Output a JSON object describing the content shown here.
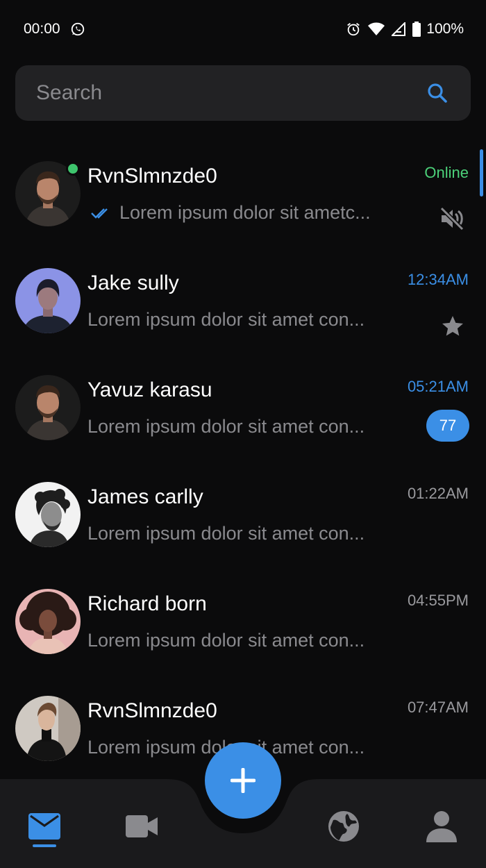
{
  "status_bar": {
    "time": "00:00",
    "battery": "100%",
    "icons": [
      "whatsapp-icon",
      "alarm-icon",
      "wifi-icon",
      "signal-icon",
      "battery-icon"
    ]
  },
  "search": {
    "placeholder": "Search",
    "value": ""
  },
  "chats": [
    {
      "name": "RvnSlmnzde0",
      "preview": "Lorem ipsum dolor sit ametc...",
      "time": "Online",
      "time_color": "#4cd27a",
      "online": true,
      "read_ticks": true,
      "muted": true
    },
    {
      "name": "Jake sully",
      "preview": "Lorem ipsum dolor sit amet con...",
      "time": "12:34AM",
      "time_color": "#3b8fe6",
      "starred": true
    },
    {
      "name": "Yavuz karasu",
      "preview": "Lorem ipsum dolor sit amet con...",
      "time": "05:21AM",
      "time_color": "#3b8fe6",
      "unread": "77"
    },
    {
      "name": "James carlly",
      "preview": "Lorem ipsum dolor sit amet con...",
      "time": "01:22AM",
      "time_color": "#9a9a9e"
    },
    {
      "name": "Richard born",
      "preview": "Lorem ipsum dolor sit amet con...",
      "time": "04:55PM",
      "time_color": "#9a9a9e"
    },
    {
      "name": "RvnSlmnzde0",
      "preview": "Lorem ipsum dolor sit amet con...",
      "time": "07:47AM",
      "time_color": "#9a9a9e"
    }
  ],
  "bottom_nav": {
    "items": [
      "mail-icon",
      "video-icon",
      "globe-icon",
      "profile-icon"
    ],
    "active": "mail-icon",
    "fab_icon": "plus-icon"
  },
  "colors": {
    "accent": "#3b8fe6",
    "online": "#4cd27a",
    "background": "#0b0b0c",
    "surface": "#222224"
  }
}
